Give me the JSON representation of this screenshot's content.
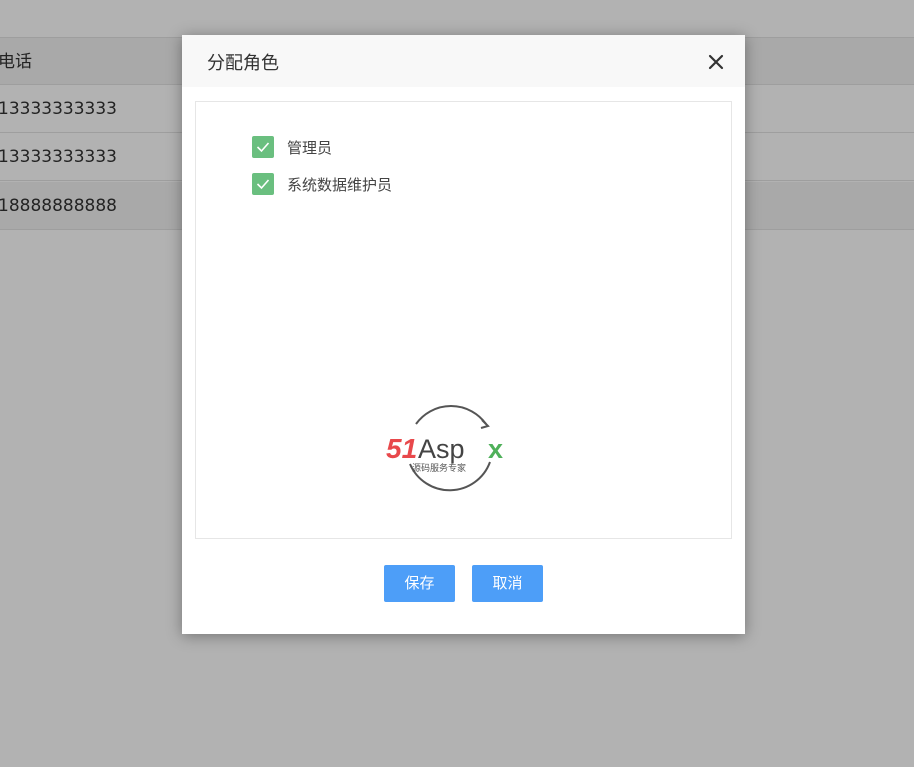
{
  "background_table": {
    "header_label": "电话",
    "rows": [
      "13333333333",
      "13333333333",
      "18888888888"
    ]
  },
  "dialog": {
    "title": "分配角色",
    "close_icon": "close-icon",
    "roles": [
      {
        "label": "管理员",
        "checked": true
      },
      {
        "label": "系统数据维护员",
        "checked": true
      }
    ],
    "logo": {
      "brand_red": "51",
      "brand_dark": "Asp",
      "brand_green": "x",
      "tagline": "源码服务专家"
    },
    "buttons": {
      "save": "保存",
      "cancel": "取消"
    }
  },
  "colors": {
    "checkbox_checked": "#6abf7f",
    "button_primary": "#4d9ef8",
    "overlay": "rgba(0,0,0,0.30)"
  }
}
